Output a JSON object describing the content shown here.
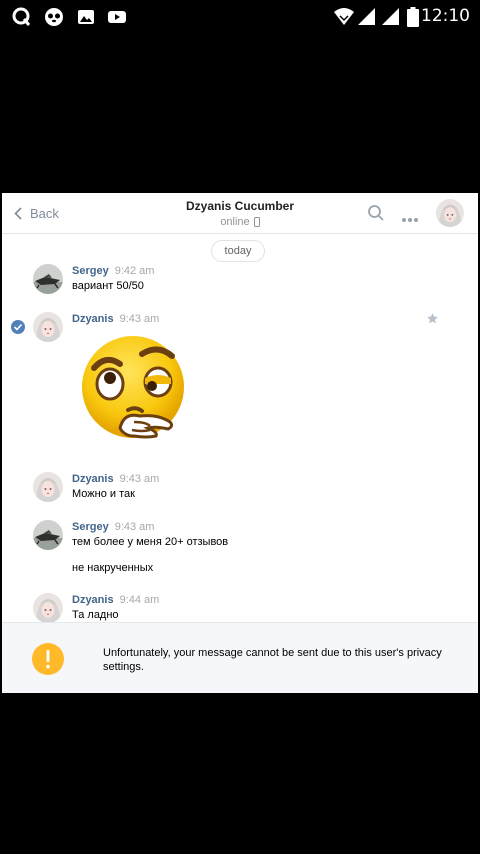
{
  "status_bar": {
    "time": "12:10",
    "left_icons": [
      "quora-icon",
      "panda-app-icon",
      "gallery-icon",
      "youtube-icon"
    ],
    "right_icons": [
      "wifi-icon",
      "signal-icon",
      "signal-icon-2",
      "battery-icon"
    ]
  },
  "header": {
    "back_label": "Back",
    "title": "Dzyanis Cucumber",
    "status": "online"
  },
  "chat": {
    "date_separator": "today",
    "messages": [
      {
        "author": "Sergey",
        "time": "9:42 am",
        "lines": [
          "вариант 50/50"
        ]
      },
      {
        "author": "Dzyanis",
        "time": "9:43 am",
        "sticker": "thinking-face-sticker"
      },
      {
        "author": "Dzyanis",
        "time": "9:43 am",
        "lines": [
          "Можно и так"
        ]
      },
      {
        "author": "Sergey",
        "time": "9:43 am",
        "lines": [
          "тем более у меня 20+ отзывов",
          "не накрученных"
        ]
      },
      {
        "author": "Dzyanis",
        "time": "9:44 am",
        "lines": [
          "Та ладно"
        ]
      }
    ]
  },
  "notice": {
    "text": "Unfortunately, your message cannot be sent due to this user's privacy settings."
  },
  "colors": {
    "author_link": "#42648b",
    "accent": "#5181b8",
    "warning": "#ffb929"
  }
}
